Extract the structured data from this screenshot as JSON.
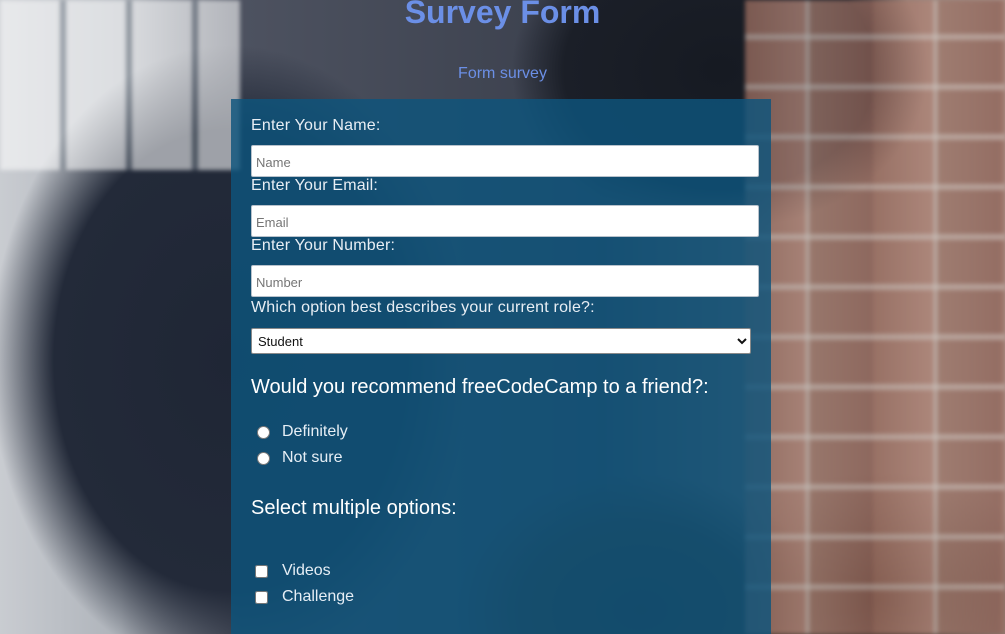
{
  "header": {
    "title": "Survey Form",
    "subtitle": "Form survey"
  },
  "form": {
    "name": {
      "label": "Enter Your Name:",
      "placeholder": "Name",
      "value": ""
    },
    "email": {
      "label": "Enter Your Email:",
      "placeholder": "Email",
      "value": ""
    },
    "number": {
      "label": "Enter Your Number:",
      "placeholder": "Number",
      "value": ""
    },
    "role": {
      "label": "Which option best describes your current role?:",
      "selected": "Student"
    },
    "recommend": {
      "question": "Would you recommend freeCodeCamp to a friend?:",
      "options": [
        "Definitely",
        "Not sure"
      ]
    },
    "multi": {
      "question": "Select multiple options:",
      "options": [
        "Videos",
        "Challenge"
      ]
    }
  },
  "colors": {
    "title": "#6b8fe6",
    "card": "#0d547c"
  }
}
